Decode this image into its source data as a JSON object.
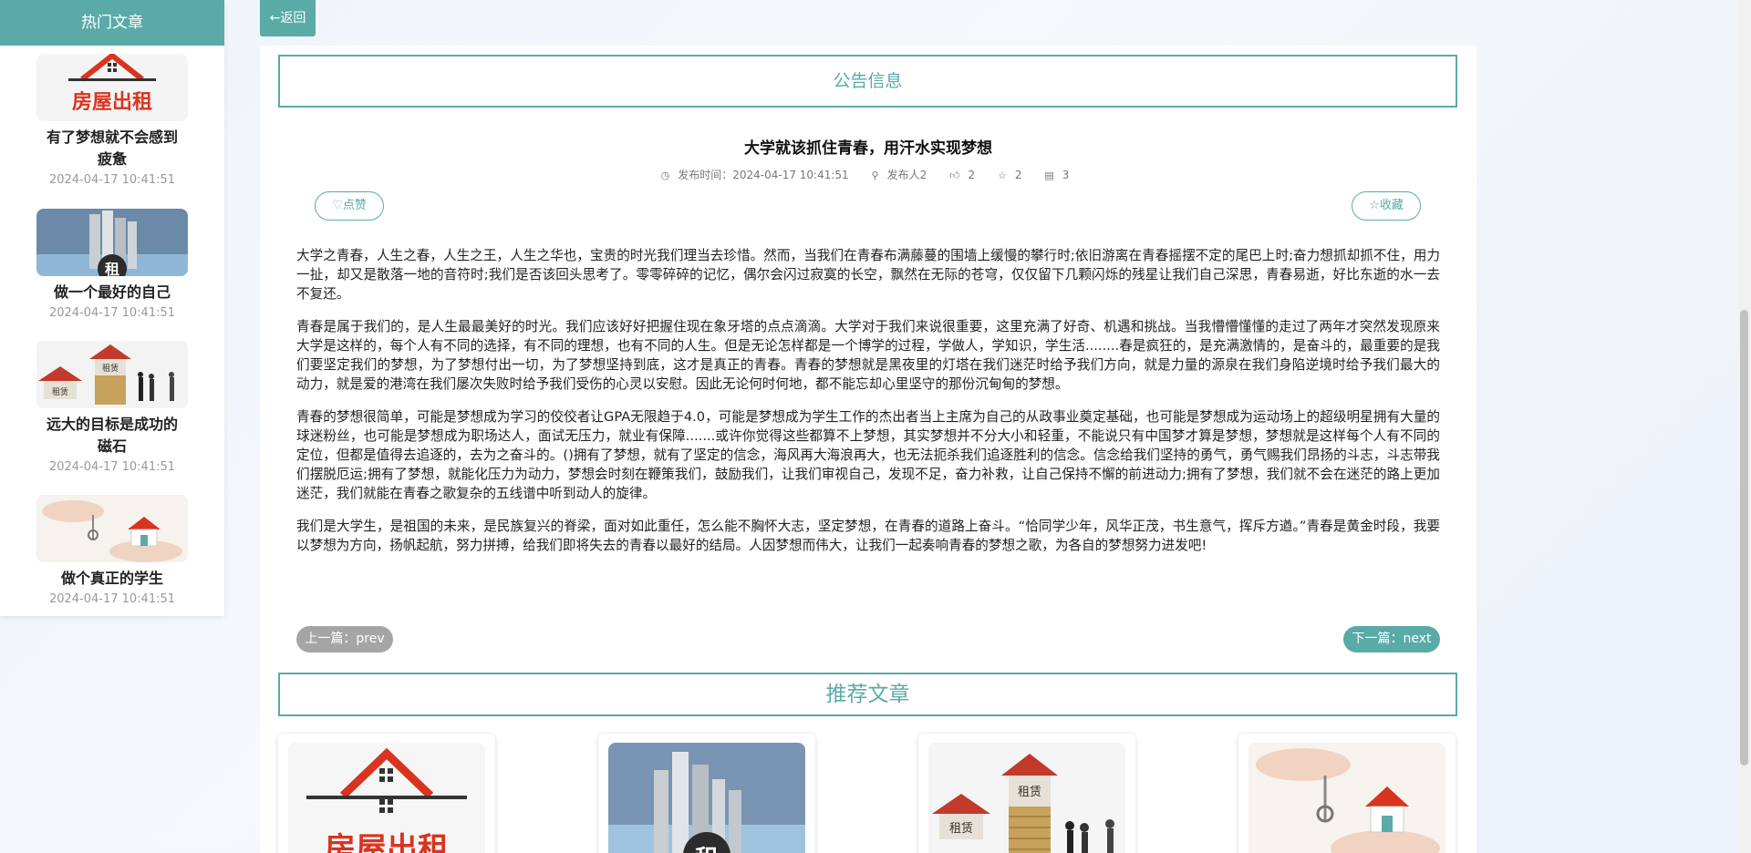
{
  "sidebar": {
    "heading": "热门文章",
    "items": [
      {
        "title": "有了梦想就不会感到疲惫",
        "date": "2024-04-17 10:41:51",
        "image": "house-rent-logo"
      },
      {
        "title": "做一个最好的自己",
        "date": "2024-04-17 10:41:51",
        "image": "city-buildings-rent"
      },
      {
        "title": "远大的目标是成功的磁石",
        "date": "2024-04-17 10:41:51",
        "image": "houses-on-coins"
      },
      {
        "title": "做个真正的学生",
        "date": "2024-04-17 10:41:51",
        "image": "hand-key-house"
      }
    ]
  },
  "back_button": {
    "label": "←返回"
  },
  "notice_heading": "公告信息",
  "article": {
    "title": "大学就该抓住青春，用汗水实现梦想",
    "meta": {
      "publish_label": "发布时间：2024-04-17 10:41:51",
      "author": "发布人2",
      "likes": "2",
      "favorites": "2",
      "comments": "3"
    },
    "like_label": "点赞",
    "favorite_label": "收藏",
    "paragraphs": [
      "大学之青春，人生之春，人生之王，人生之华也，宝贵的时光我们理当去珍惜。然而，当我们在青春布满藤蔓的围墙上缓慢的攀行时;依旧游离在青春摇摆不定的尾巴上时;奋力想抓却抓不住，用力一扯，却又是散落一地的音符时;我们是否该回头思考了。零零碎碎的记忆，偶尔会闪过寂寞的长空，飘然在无际的苍穹，仅仅留下几颗闪烁的残星让我们自己深思，青春易逝，好比东逝的水一去不复还。",
      "青春是属于我们的，是人生最最美好的时光。我们应该好好把握住现在象牙塔的点点滴滴。大学对于我们来说很重要，这里充满了好奇、机遇和挑战。当我懵懵懂懂的走过了两年才突然发现原来大学是这样的，每个人有不同的选择，有不同的理想，也有不同的人生。但是无论怎样都是一个博学的过程，学做人，学知识，学生活........春是疯狂的，是充满激情的，是奋斗的，最重要的是我们要坚定我们的梦想，为了梦想付出一切，为了梦想坚持到底，这才是真正的青春。青春的梦想就是黑夜里的灯塔在我们迷茫时给予我们方向，就是力量的源泉在我们身陷逆境时给予我们最大的动力，就是爱的港湾在我们屡次失败时给予我们受伤的心灵以安慰。因此无论何时何地，都不能忘却心里坚守的那份沉甸甸的梦想。",
      "青春的梦想很简单，可能是梦想成为学习的佼佼者让GPA无限趋于4.0，可能是梦想成为学生工作的杰出者当上主席为自己的从政事业奠定基础，也可能是梦想成为运动场上的超级明星拥有大量的球迷粉丝，也可能是梦想成为职场达人，面试无压力，就业有保障.......或许你觉得这些都算不上梦想，其实梦想并不分大小和轻重，不能说只有中国梦才算是梦想，梦想就是这样每个人有不同的定位，但都是值得去追逐的，去为之奋斗的。()拥有了梦想，就有了坚定的信念，海风再大海浪再大，也无法扼杀我们追逐胜利的信念。信念给我们坚持的勇气，勇气赐我们昂扬的斗志，斗志带我们摆脱厄运;拥有了梦想，就能化压力为动力，梦想会时刻在鞭策我们，鼓励我们，让我们审视自己，发现不足，奋力补救，让自己保持不懈的前进动力;拥有了梦想，我们就不会在迷茫的路上更加迷茫，我们就能在青春之歌复杂的五线谱中听到动人的旋律。",
      "我们是大学生，是祖国的未来，是民族复兴的脊梁，面对如此重任，怎么能不胸怀大志，坚定梦想，在青春的道路上奋斗。“恰同学少年，风华正茂，书生意气，挥斥方遒。”青春是黄金时段，我要以梦想为方向，扬帆起航，努力拼搏，给我们即将失去的青春以最好的结局。人因梦想而伟大，让我们一起奏响青春的梦想之歌，为各自的梦想努力进发吧!"
    ],
    "prev_label": "上一篇：prev",
    "next_label": "下一篇：next"
  },
  "recommend_heading": "推荐文章",
  "recommend": [
    {
      "image": "house-rent-logo"
    },
    {
      "image": "city-buildings-rent"
    },
    {
      "image": "houses-on-coins"
    },
    {
      "image": "hand-key-house"
    }
  ],
  "image_text": {
    "rent_logo": "房屋出租",
    "rent_sign": "租",
    "rent_sign2": "租赁"
  },
  "colors": {
    "accent": "#5aaaa8",
    "prev_bg": "#a5a5a5",
    "logo_red": "#d9341f"
  }
}
